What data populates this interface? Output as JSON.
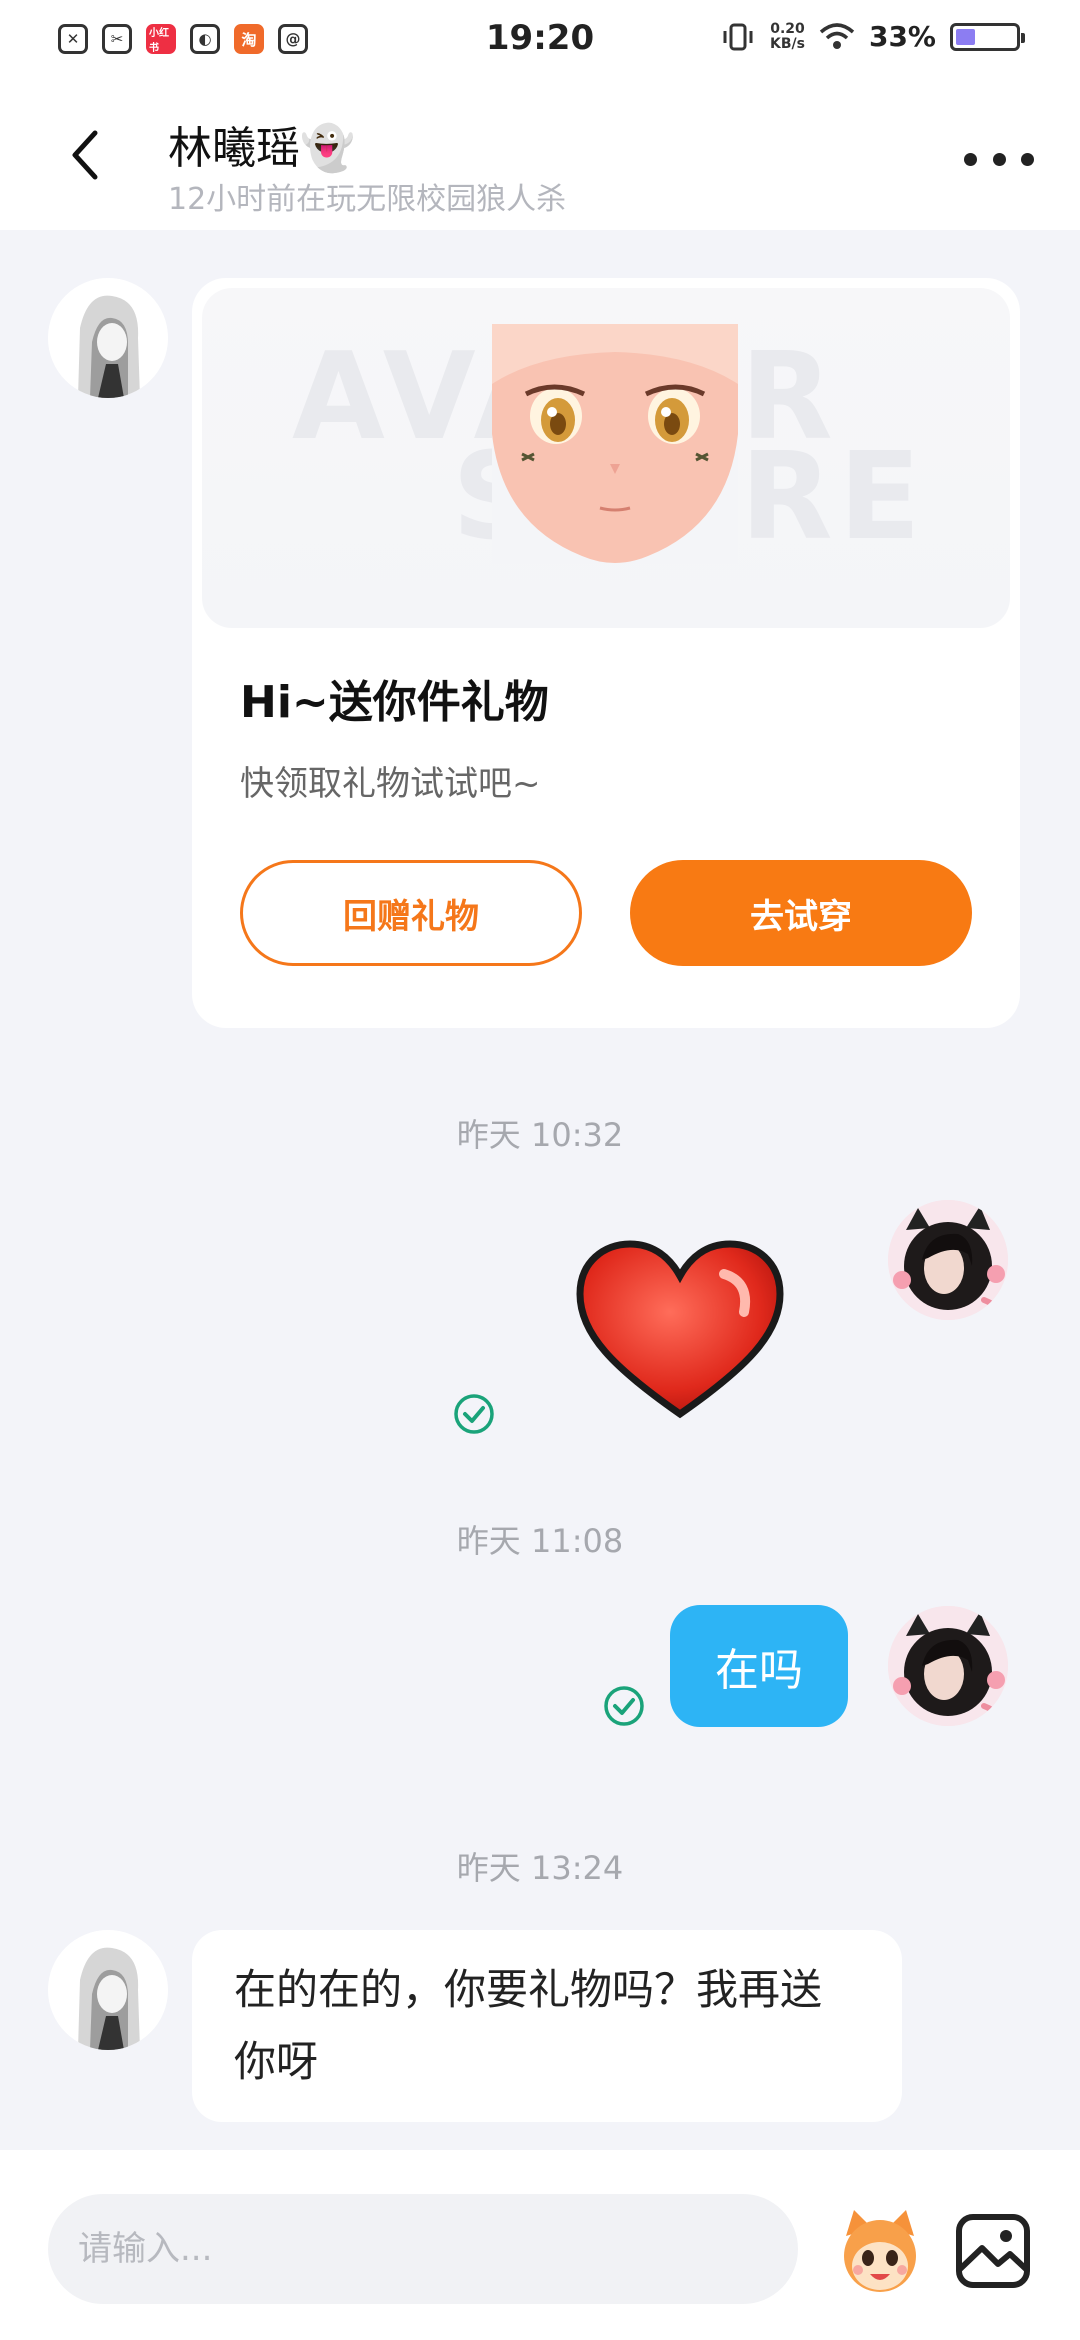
{
  "status_bar": {
    "time": "19:20",
    "net_speed_value": "0.20",
    "net_speed_unit": "KB/s",
    "battery_pct": "33%",
    "battery_level": 0.33,
    "mini_app_label": "小红书"
  },
  "header": {
    "name": "林曦瑶👻",
    "status": "12小时前在玩无限校园狼人杀"
  },
  "gift_card": {
    "banner_text_1": "AVATAR",
    "banner_text_2": "STORE",
    "title": "Hi~送你件礼物",
    "subtitle": "快领取礼物试试吧~",
    "return_gift_label": "回赠礼物",
    "try_on_label": "去试穿"
  },
  "messages": {
    "ts1": "昨天 10:32",
    "ts2": "昨天 11:08",
    "bubble_1": "在吗",
    "ts3": "昨天 13:24",
    "bubble_2": "在的在的，你要礼物吗？我再送你呀"
  },
  "input": {
    "placeholder": "请输入..."
  },
  "colors": {
    "accent_orange": "#f87a13",
    "bubble_blue": "#2db4f5",
    "sent_check": "#1aa37a"
  }
}
